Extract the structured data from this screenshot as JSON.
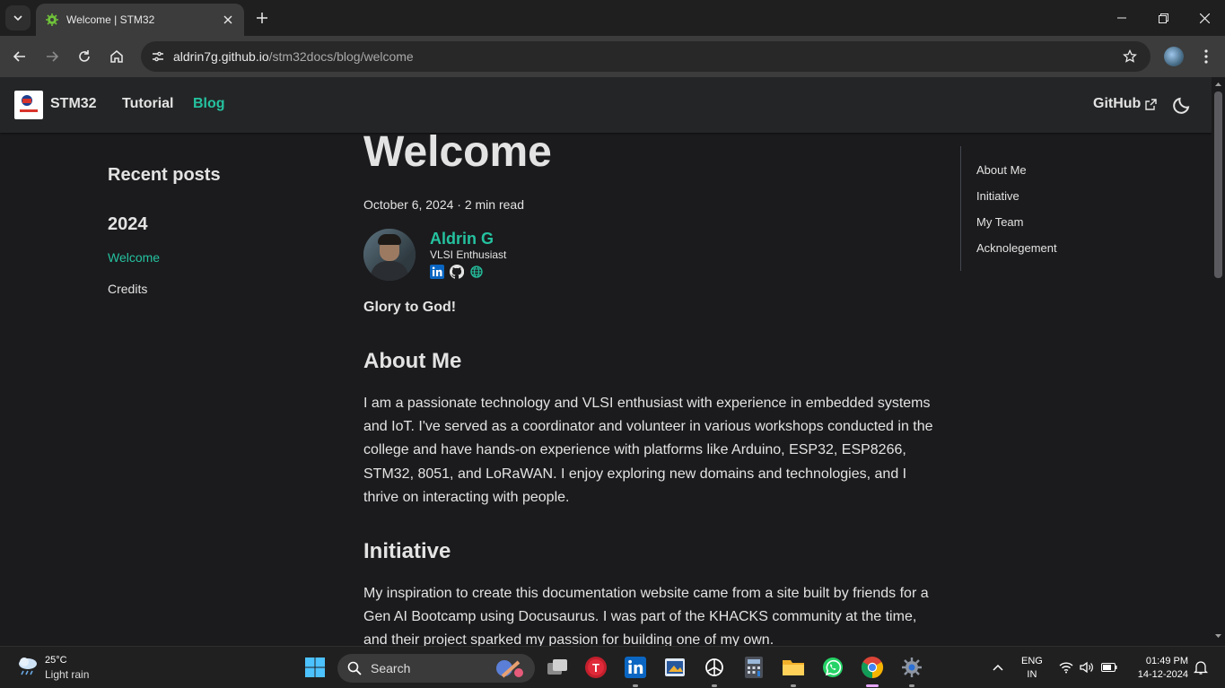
{
  "browser": {
    "tab": {
      "title": "Welcome | STM32"
    },
    "url": {
      "host": "aldrin7g.github.io",
      "path": "/stm32docs/blog/welcome"
    }
  },
  "navbar": {
    "brand": "STM32",
    "links": [
      {
        "label": "Tutorial",
        "active": false
      },
      {
        "label": "Blog",
        "active": true
      }
    ],
    "github_label": "GitHub"
  },
  "sidebar": {
    "heading": "Recent posts",
    "year": "2024",
    "posts": [
      {
        "label": "Welcome",
        "active": true
      },
      {
        "label": "Credits",
        "active": false
      }
    ]
  },
  "article": {
    "title": "Welcome",
    "meta": "October 6, 2024 · 2 min read",
    "author": {
      "name": "Aldrin G",
      "role": "VLSI Enthusiast"
    },
    "tagline": "Glory to God!",
    "sections": [
      {
        "heading": "About Me",
        "text": "I am a passionate technology and VLSI enthusiast with experience in embedded systems and IoT. I've served as a coordinator and volunteer in various workshops conducted in the college and have hands-on experience with platforms like Arduino, ESP32, ESP8266, STM32, 8051, and LoRaWAN. I enjoy exploring new domains and technologies, and I thrive on interacting with people."
      },
      {
        "heading": "Initiative",
        "text": "My inspiration to create this documentation website came from a site built by friends for a Gen AI Bootcamp using Docusaurus. I was part of the KHACKS community at the time, and their project sparked my passion for building one of my own."
      }
    ]
  },
  "toc": {
    "items": [
      "About Me",
      "Initiative",
      "My Team",
      "Acknolegement"
    ]
  },
  "taskbar": {
    "weather": {
      "temp": "25°C",
      "desc": "Light rain"
    },
    "search_label": "Search",
    "lang": {
      "line1": "ENG",
      "line2": "IN"
    },
    "clock": {
      "time": "01:49 PM",
      "date": "14-12-2024"
    }
  },
  "colors": {
    "accent": "#25c2a0",
    "page_bg": "#1b1b1d",
    "navbar_bg": "#242526"
  }
}
